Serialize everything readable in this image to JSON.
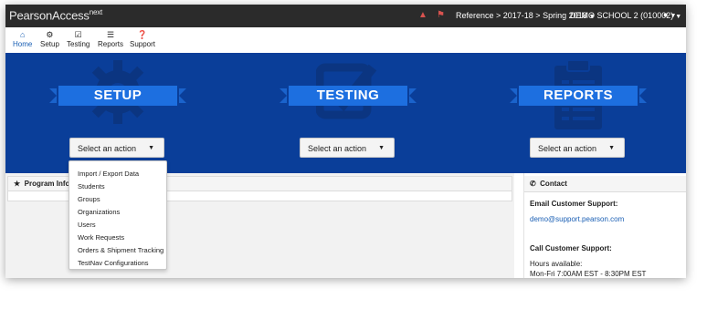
{
  "topbar": {
    "brand": "PearsonAccess",
    "brand_sup": "next",
    "breadcrumb": "Reference > 2017-18 > Spring 2018",
    "school": "DEMO SCHOOL 2 (010002)"
  },
  "nav": {
    "items": [
      {
        "label": "Home",
        "icon": "home-icon"
      },
      {
        "label": "Setup",
        "icon": "gear-icon"
      },
      {
        "label": "Testing",
        "icon": "checkbox-icon"
      },
      {
        "label": "Reports",
        "icon": "list-icon"
      },
      {
        "label": "Support",
        "icon": "question-icon"
      }
    ]
  },
  "banner": {
    "color": "#0a3e99",
    "ribbon_color": "#1d6fe0",
    "sections": [
      {
        "title": "SETUP",
        "select_label": "Select an action"
      },
      {
        "title": "TESTING",
        "select_label": "Select an action"
      },
      {
        "title": "REPORTS",
        "select_label": "Select an action"
      }
    ]
  },
  "dropdown": {
    "items": [
      "Import / Export Data",
      "Students",
      "Groups",
      "Organizations",
      "Users",
      "Work Requests",
      "Orders & Shipment Tracking",
      "TestNav Configurations"
    ]
  },
  "program_info": {
    "title": "Program Inform"
  },
  "contact": {
    "title": "Contact",
    "email_label": "Email Customer Support:",
    "email": "demo@support.pearson.com",
    "call_label": "Call Customer Support:",
    "hours_label": "Hours available:",
    "hours": "Mon-Fri 7:00AM EST - 8:30PM EST"
  }
}
